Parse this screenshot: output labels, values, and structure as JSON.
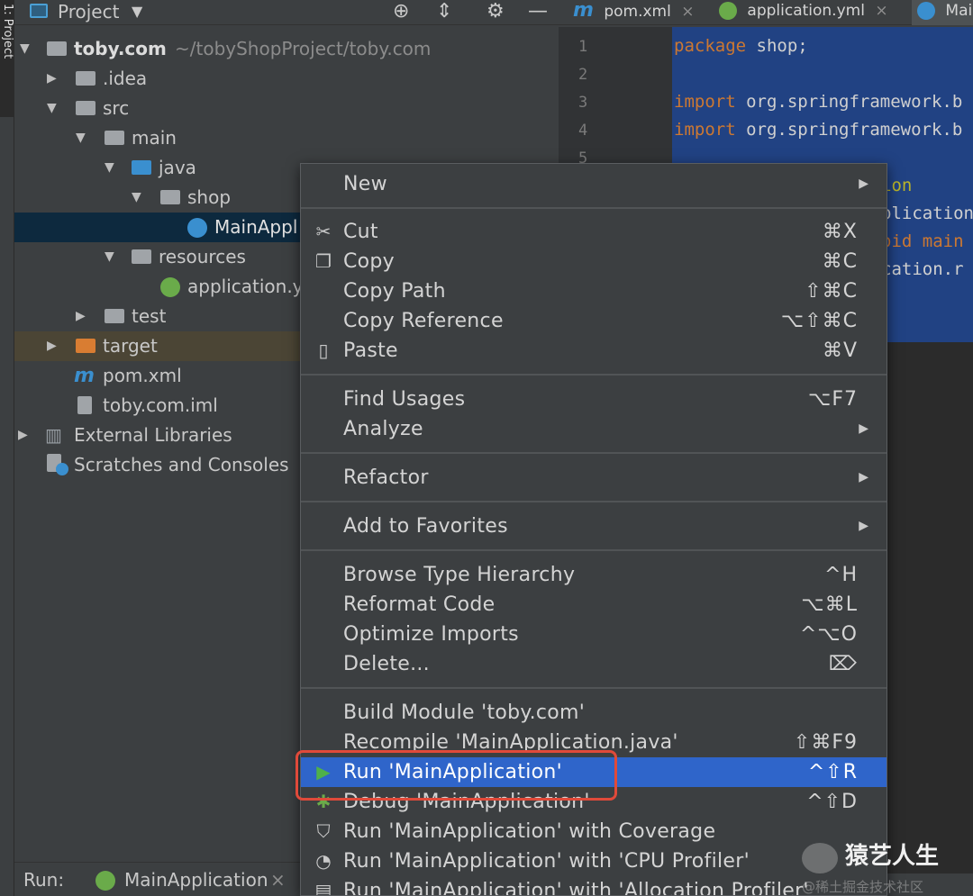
{
  "tool_window_tab": "1: Project",
  "project_panel": {
    "title": "Project",
    "tree": [
      {
        "label": "toby.com",
        "sub": "~/tobyShopProject/toby.com",
        "bold": true
      },
      {
        "label": ".idea"
      },
      {
        "label": "src"
      },
      {
        "label": "main"
      },
      {
        "label": "java"
      },
      {
        "label": "shop"
      },
      {
        "label": "MainAppl"
      },
      {
        "label": "resources"
      },
      {
        "label": "application.y"
      },
      {
        "label": "test"
      },
      {
        "label": "target"
      },
      {
        "label": "pom.xml"
      },
      {
        "label": "toby.com.iml"
      },
      {
        "label": "External Libraries"
      },
      {
        "label": "Scratches and Consoles"
      }
    ]
  },
  "editor_tabs": [
    {
      "label": "pom.xml",
      "icon": "maven-icon"
    },
    {
      "label": "application.yml",
      "icon": "spring-icon"
    },
    {
      "label": "Mai",
      "icon": "spring-class-icon"
    }
  ],
  "editor": {
    "line_numbers": [
      "1",
      "2",
      "3",
      "4",
      "5"
    ],
    "lines": [
      {
        "kw": "package",
        "rest": " shop;"
      },
      {
        "kw": "",
        "rest": ""
      },
      {
        "kw": "import",
        "rest": " org.springframework.b"
      },
      {
        "kw": "import",
        "rest": " org.springframework.b"
      },
      {
        "kw": "",
        "rest": ""
      },
      {
        "kw": "",
        "rest": "ion"
      },
      {
        "kw": "",
        "rest": "plication"
      },
      {
        "kw": "",
        "rest": "oid main"
      },
      {
        "kw": "",
        "rest": "cation.r"
      }
    ]
  },
  "context_menu": {
    "new": "New",
    "cut": {
      "label": "Cut",
      "shortcut": "⌘X"
    },
    "copy": {
      "label": "Copy",
      "shortcut": "⌘C"
    },
    "copy_path": {
      "label": "Copy Path",
      "shortcut": "⇧⌘C"
    },
    "copy_reference": {
      "label": "Copy Reference",
      "shortcut": "⌥⇧⌘C"
    },
    "paste": {
      "label": "Paste",
      "shortcut": "⌘V"
    },
    "find_usages": {
      "label": "Find Usages",
      "shortcut": "⌥F7"
    },
    "analyze": "Analyze",
    "refactor": "Refactor",
    "add_to_favorites": "Add to Favorites",
    "browse_type_hierarchy": {
      "label": "Browse Type Hierarchy",
      "shortcut": "^H"
    },
    "reformat_code": {
      "label": "Reformat Code",
      "shortcut": "⌥⌘L"
    },
    "optimize_imports": {
      "label": "Optimize Imports",
      "shortcut": "^⌥O"
    },
    "delete": {
      "label": "Delete...",
      "shortcut": "⌦"
    },
    "build_module": "Build Module 'toby.com'",
    "recompile": {
      "label": "Recompile 'MainApplication.java'",
      "shortcut": "⇧⌘F9"
    },
    "run": {
      "label": "Run 'MainApplication'",
      "shortcut": "^⇧R"
    },
    "debug": {
      "label": "Debug 'MainApplication'",
      "shortcut": "^⇧D"
    },
    "run_coverage": "Run 'MainApplication' with Coverage",
    "run_cpu": "Run 'MainApplication' with 'CPU Profiler'",
    "run_alloc": "Run 'MainApplication' with 'Allocation Profiler'"
  },
  "run_bar": {
    "label": "Run:",
    "config": "MainApplication"
  },
  "watermark": {
    "title": "猿艺人生",
    "subtitle": "@稀土掘金技术社区"
  },
  "colors": {
    "highlight": "#2f65ca",
    "callout": "#e04a3a",
    "editor_selection": "#214283"
  }
}
